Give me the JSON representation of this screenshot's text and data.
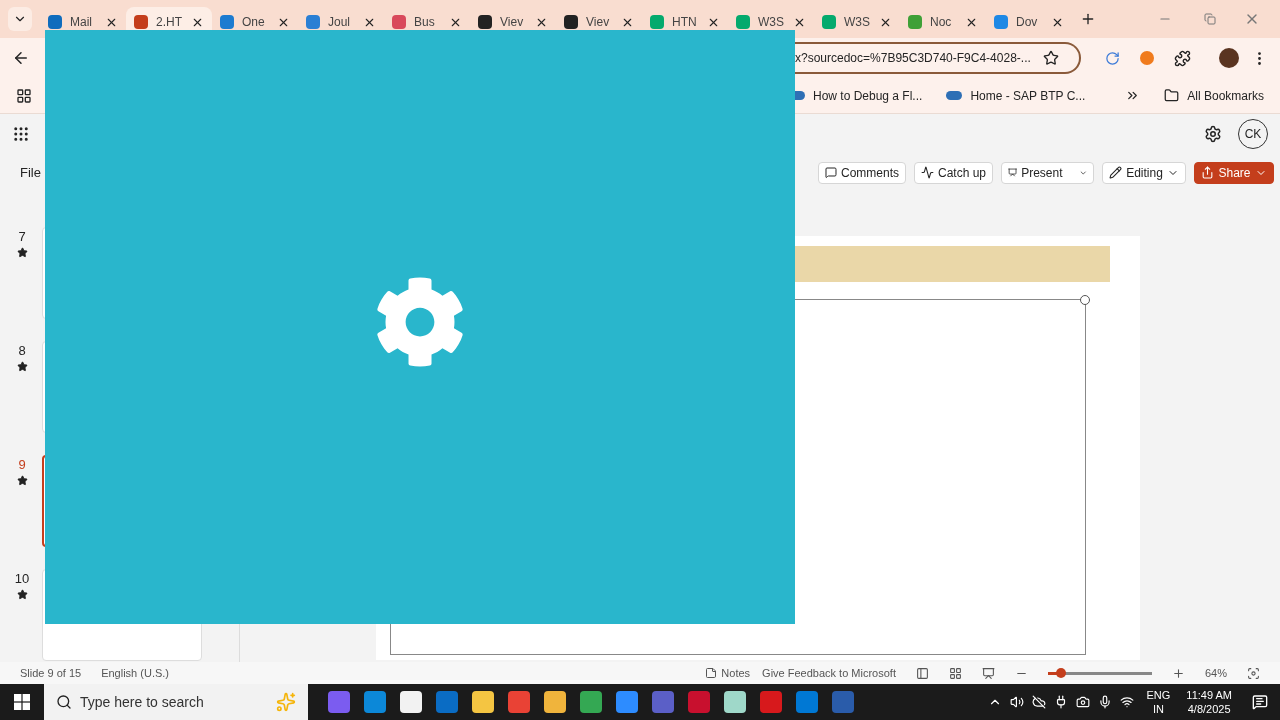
{
  "browser": {
    "tabs": [
      {
        "label": "Mail",
        "selected": false,
        "color": "#0f6cbd"
      },
      {
        "label": "2.HT",
        "selected": true,
        "color": "#c43e1c"
      },
      {
        "label": "One",
        "selected": false,
        "color": "#1c7bd0"
      },
      {
        "label": "Joul",
        "selected": false,
        "color": "#2a7fd4"
      },
      {
        "label": "Bus",
        "selected": false,
        "color": "#d9495b"
      },
      {
        "label": "Viev",
        "selected": false,
        "color": "#222222"
      },
      {
        "label": "Viev",
        "selected": false,
        "color": "#222222"
      },
      {
        "label": "HTN",
        "selected": false,
        "color": "#04aa6d"
      },
      {
        "label": "W3S",
        "selected": false,
        "color": "#04aa6d"
      },
      {
        "label": "W3S",
        "selected": false,
        "color": "#04aa6d"
      },
      {
        "label": "Noc",
        "selected": false,
        "color": "#3fa037"
      },
      {
        "label": "Dov",
        "selected": false,
        "color": "#1e88e5"
      }
    ],
    "url": "x?sourcedoc=%7B95C3D740-F9C4-4028-...",
    "bookmarks": [
      "How to Debug a Fl...",
      "Home - SAP BTP C..."
    ],
    "all_bookmarks": "All Bookmarks"
  },
  "app": {
    "file_menu": "File",
    "avatar": "CK",
    "buttons": [
      "Comments",
      "Catch up",
      "Present",
      "Editing",
      "Share"
    ],
    "slides": [
      {
        "number": "7",
        "selected": false
      },
      {
        "number": "8",
        "selected": false
      },
      {
        "number": "9",
        "selected": true
      },
      {
        "number": "10",
        "selected": false
      }
    ],
    "status": {
      "slide": "Slide 9 of 15",
      "language": "English (U.S.)",
      "notes": "Notes",
      "feedback": "Give Feedback to Microsoft",
      "zoom": {
        "level": 0.13
      },
      "zoom_reading": "64%"
    }
  },
  "taskbar": {
    "search_placeholder": "Type here to search",
    "language": "ENG",
    "region": "IN",
    "time": "11:49 AM",
    "date": "4/8/2025"
  }
}
